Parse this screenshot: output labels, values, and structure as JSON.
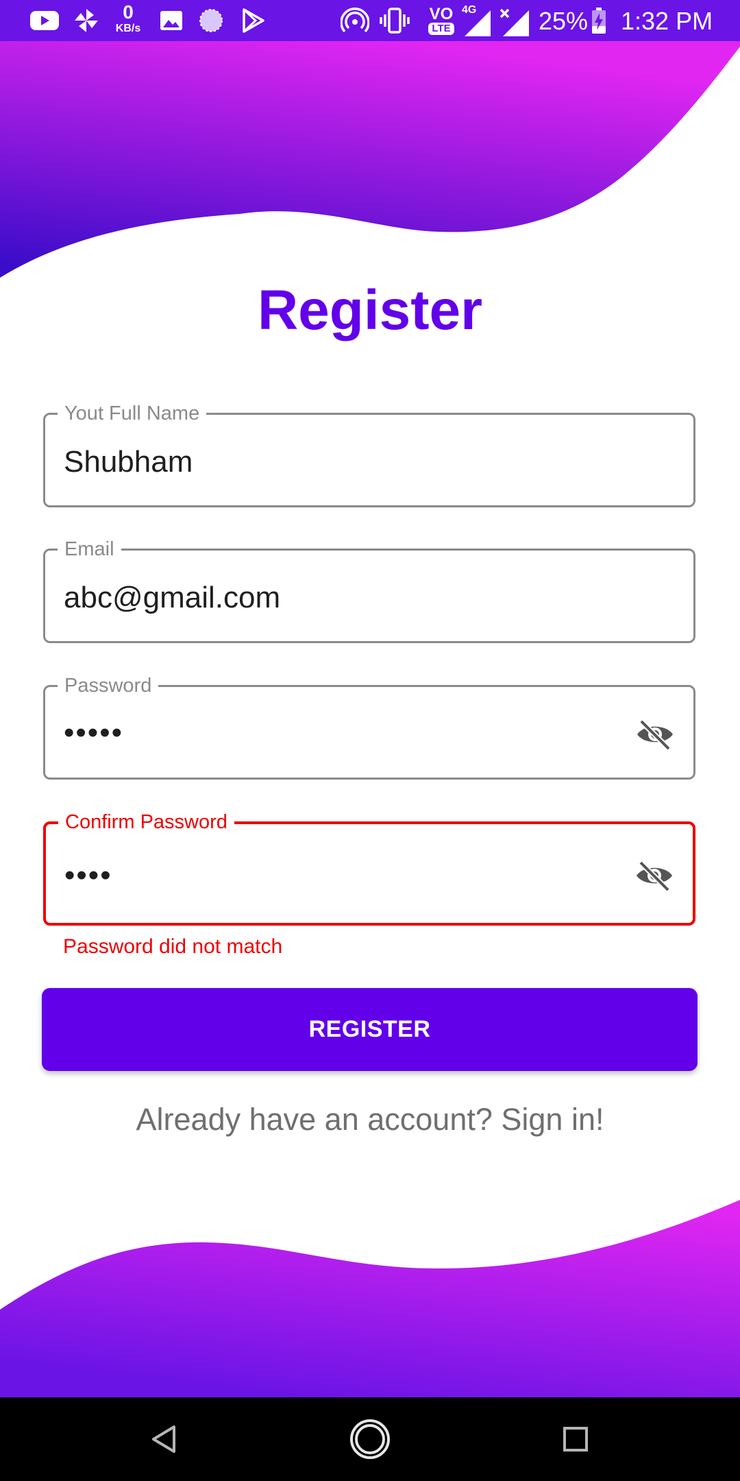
{
  "status_bar": {
    "net_speed_value": "0",
    "net_speed_unit": "KB/s",
    "volte_label": "VO",
    "lte_label": "LTE",
    "network_label": "4G",
    "battery": "25%",
    "time": "1:32 PM",
    "icons": [
      "youtube-icon",
      "pinwheel-icon",
      "gallery-icon",
      "circle-app-icon",
      "play-store-icon",
      "hotspot-icon",
      "vibrate-icon",
      "volte-icon",
      "signal-icon",
      "signal-x-icon",
      "battery-charging-icon"
    ]
  },
  "colors": {
    "primary": "#6200ea",
    "status_bar": "#6a14e6",
    "wave_gradient_start": "#e226f2",
    "wave_gradient_end": "#3b0cc9",
    "error": "#ee0000",
    "field_border": "#8a8a8a"
  },
  "page": {
    "title": "Register"
  },
  "form": {
    "full_name": {
      "label": "Yout Full Name",
      "value": "Shubham"
    },
    "email": {
      "label": "Email",
      "value": "abc@gmail.com"
    },
    "password": {
      "label": "Password",
      "value_masked": "•••••",
      "toggle_icon": "eye-off-icon"
    },
    "confirm_password": {
      "label": "Confirm Password",
      "value_masked": "••••",
      "toggle_icon": "eye-off-icon",
      "error": "Password did not match"
    },
    "submit_label": "REGISTER",
    "signin_prompt": "Already have an account? Sign in!"
  },
  "nav_bar": {
    "buttons": [
      "back-icon",
      "home-icon",
      "recents-icon"
    ]
  }
}
